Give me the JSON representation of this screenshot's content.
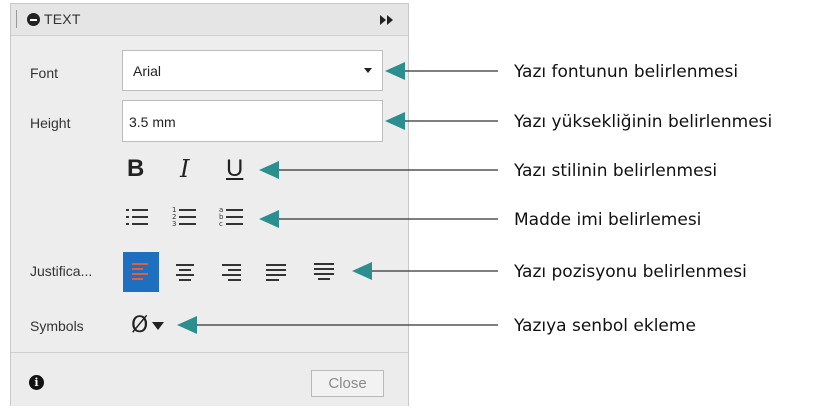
{
  "panel": {
    "title": "TEXT",
    "font_label": "Font",
    "font_value": "Arial",
    "height_label": "Height",
    "height_value": "3.5 mm",
    "style_buttons": {
      "bold": "B",
      "italic": "I",
      "underline": "U"
    },
    "justification_label": "Justifica...",
    "symbols_label": "Symbols",
    "symbol_value": "Ø",
    "close_label": "Close",
    "info_glyph": "i"
  },
  "annotations": [
    "Yazı fontunun belirlenmesi",
    "Yazı yüksekliğinin belirlenmesi",
    "Yazı stilinin belirlenmesi",
    "Madde imi belirlemesi",
    "Yazı pozisyonu belirlenmesi",
    "Yazıya senbol ekleme"
  ],
  "colors": {
    "arrow": "#2b8f8f",
    "active_justify": "#1e6fc0",
    "panel_bg": "#ededed"
  },
  "icons": [
    "minus-circle-icon",
    "expand-icon",
    "bullet-list-icon",
    "numbered-list-icon",
    "lettered-list-icon",
    "align-left-icon",
    "align-center-icon",
    "align-right-icon",
    "justify-icon",
    "justify-all-icon",
    "info-icon"
  ]
}
